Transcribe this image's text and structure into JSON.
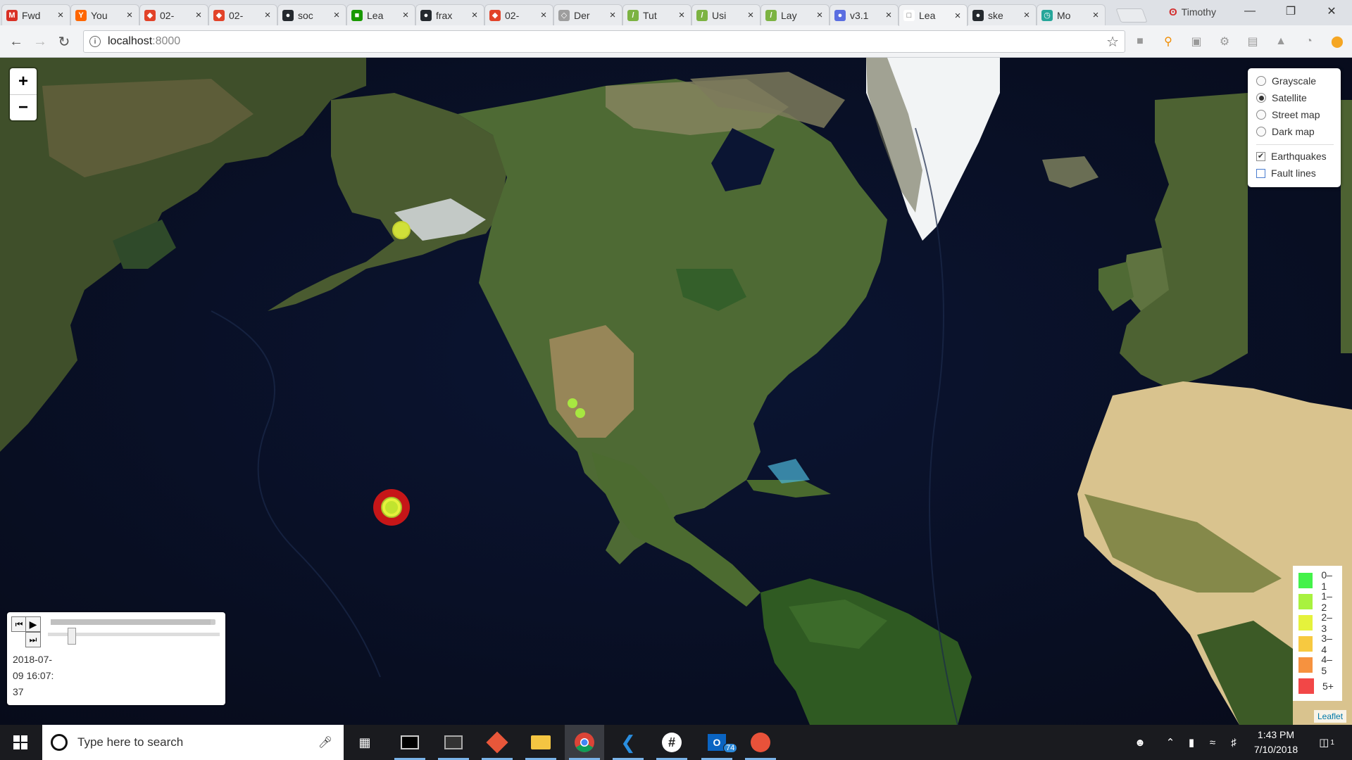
{
  "browser": {
    "tabs": [
      {
        "label": "Fwd",
        "icon": "gmail-icon",
        "color": "#d93025",
        "glyph": "M"
      },
      {
        "label": "You",
        "icon": "ycombinator-icon",
        "color": "#ff6600",
        "glyph": "Y"
      },
      {
        "label": "02-",
        "icon": "gitlab-icon",
        "color": "#e24329",
        "glyph": "◆"
      },
      {
        "label": "02-",
        "icon": "gitlab-icon",
        "color": "#e24329",
        "glyph": "◆"
      },
      {
        "label": "soc",
        "icon": "github-icon",
        "color": "#24292e",
        "glyph": "●"
      },
      {
        "label": "Lea",
        "icon": "leaflet-icon",
        "color": "#199900",
        "glyph": "■"
      },
      {
        "label": "frax",
        "icon": "github-icon",
        "color": "#24292e",
        "glyph": "●"
      },
      {
        "label": "02-",
        "icon": "gitlab-icon",
        "color": "#e24329",
        "glyph": "◆"
      },
      {
        "label": "Der",
        "icon": "page-icon",
        "color": "#9e9e9e",
        "glyph": "◇"
      },
      {
        "label": "Tut",
        "icon": "pen-icon",
        "color": "#7cb342",
        "glyph": "/"
      },
      {
        "label": "Usi",
        "icon": "pen-icon",
        "color": "#7cb342",
        "glyph": "/"
      },
      {
        "label": "Lay",
        "icon": "pen-icon",
        "color": "#7cb342",
        "glyph": "/"
      },
      {
        "label": "v3.1",
        "icon": "docs-icon",
        "color": "#5b6ee1",
        "glyph": "●"
      },
      {
        "label": "Lea",
        "icon": "document-icon",
        "color": "#ffffff",
        "glyph": "□",
        "active": true
      },
      {
        "label": "ske",
        "icon": "github-icon",
        "color": "#24292e",
        "glyph": "●"
      },
      {
        "label": "Mo",
        "icon": "clock-icon",
        "color": "#26a69a",
        "glyph": "◷"
      }
    ],
    "close_glyph": "×",
    "profile_name": "Timothy",
    "url_host": "localhost",
    "url_port": ":8000"
  },
  "map": {
    "zoom_in": "+",
    "zoom_out": "−",
    "layers": {
      "base": [
        {
          "label": "Grayscale",
          "selected": false
        },
        {
          "label": "Satellite",
          "selected": true
        },
        {
          "label": "Street map",
          "selected": false
        },
        {
          "label": "Dark map",
          "selected": false
        }
      ],
      "overlays": [
        {
          "label": "Earthquakes",
          "checked": true
        },
        {
          "label": "Fault lines",
          "checked": false
        }
      ]
    },
    "legend": [
      {
        "label": "0–1",
        "color": "#44f24a"
      },
      {
        "label": "1–2",
        "color": "#a8f23f"
      },
      {
        "label": "2–3",
        "color": "#e5f23c"
      },
      {
        "label": "3–4",
        "color": "#f7c940"
      },
      {
        "label": "4–5",
        "color": "#f6923f"
      },
      {
        "label": "5+",
        "color": "#f24747"
      }
    ],
    "earthquakes": [
      {
        "place": "Alaska",
        "magnitude_class": "2–3"
      },
      {
        "place": "California",
        "magnitude_class": "1–2"
      },
      {
        "place": "California",
        "magnitude_class": "1–2"
      },
      {
        "place": "Pacific Ocean",
        "magnitude_class": "5+"
      }
    ],
    "time_control": {
      "timestamp": "2018-07-09 16:07:37",
      "progress_percent": 97,
      "speed_percent": 12
    },
    "attribution": "Leaflet"
  },
  "taskbar": {
    "search_placeholder": "Type here to search",
    "mail_badge": "74",
    "clock_time": "1:43 PM",
    "clock_date": "7/10/2018",
    "notification_count": "1"
  }
}
